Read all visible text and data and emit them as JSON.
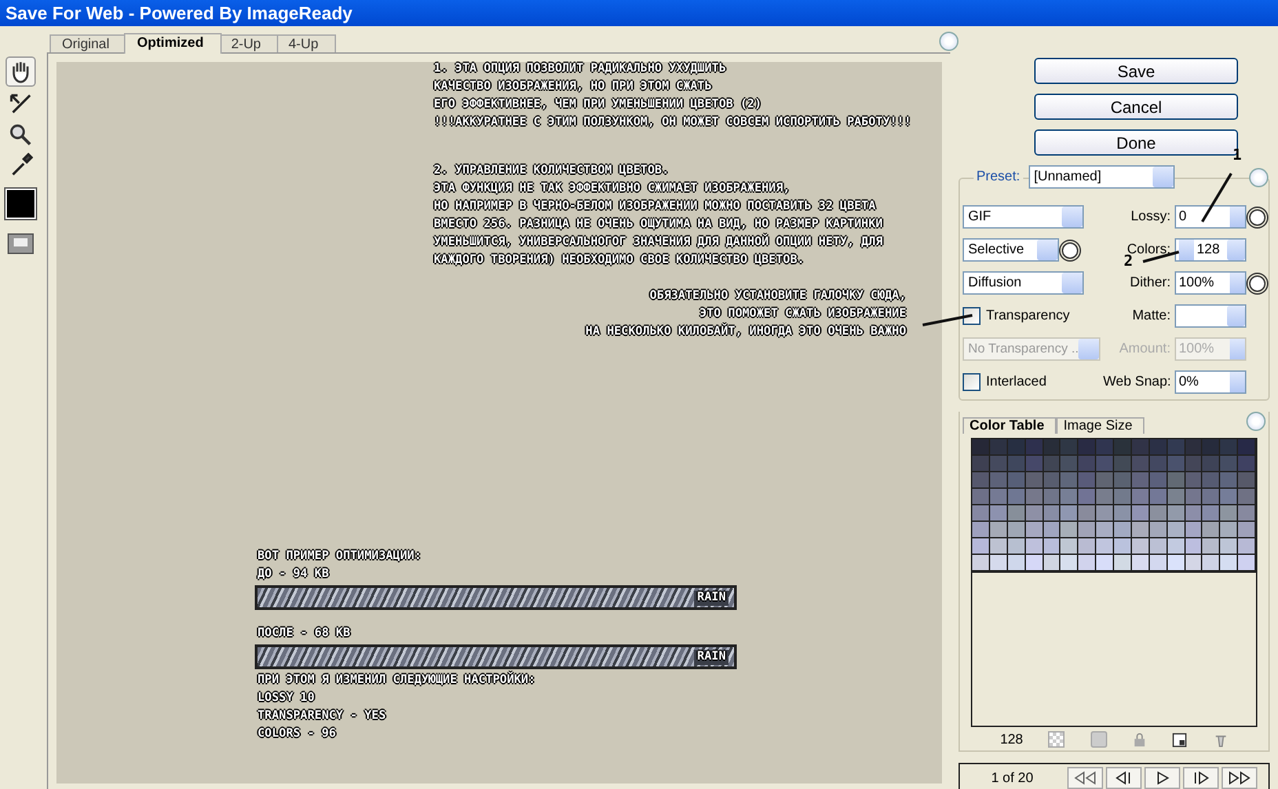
{
  "window": {
    "title": "Save For Web - Powered By ImageReady"
  },
  "tabs": [
    {
      "label": "Original",
      "selected": false
    },
    {
      "label": "Optimized",
      "selected": true
    },
    {
      "label": "2-Up",
      "selected": false
    },
    {
      "label": "4-Up",
      "selected": false
    }
  ],
  "canvas": {
    "notes": [
      {
        "lines": [
          "1. ЭТА ОПЦИЯ ПОЗВОЛИТ РАДИКАЛЬНО УХУДШИТЬ",
          "КАЧЕСТВО ИЗОБРАЖЕНИЯ, НО ПРИ ЭТОМ СЖАТЬ",
          "ЕГО ЭФФЕКТИВНЕЕ, ЧЕМ ПРИ УМЕНЬШЕНИИ ЦВЕТОВ (2)",
          "!!!АККУРАТНЕЕ С ЭТИМ ПОЛЗУНКОМ, ОН МОЖЕТ СОВСЕМ ИСПОРТИТЬ РАБОТУ!!!"
        ]
      },
      {
        "lines": [
          "2. УПРАВЛЕНИЕ КОЛИЧЕСТВОМ ЦВЕТОВ.",
          "ЭТА ФУНКЦИЯ НЕ ТАК ЭФФЕКТИВНО СЖИМАЕТ ИЗОБРАЖЕНИЯ,",
          "НО НАПРИМЕР В ЧЕРНО-БЕЛОМ ИЗОБРАЖЕНИИ МОЖНО ПОСТАВИТЬ 32 ЦВЕТА",
          "ВМЕСТО 256. РАЗНИЦА НЕ ОЧЕНЬ ОЩУТИМА НА ВИД, НО РАЗМЕР КАРТИНКИ",
          "УМЕНЬШИТСЯ, УНИВЕРСАЛЬНОГОГ ЗНАЧЕНИЯ ДЛЯ ДАННОЙ ОПЦИИ НЕТУ, ДЛЯ",
          "КАЖДОГО ТВОРЕНИЯ) НЕОБХОДИМО СВОЕ КОЛИЧЕСТВО ЦВЕТОВ."
        ]
      },
      {
        "lines": [
          "ОБЯЗАТЕЛЬНО УСТАНОВИТЕ ГАЛОЧКУ СЮДА,",
          "ЭТО ПОМОЖЕТ СЖАТЬ ИЗОБРАЖЕНИЕ",
          "НА НЕСКОЛЬКО КИЛОБАЙТ, ИНОГДА ЭТО ОЧЕНЬ ВАЖНО"
        ]
      }
    ],
    "example": [
      {
        "kind": "text",
        "text": "ВОТ ПРИМЕР ОПТИМИЗАЦИИ:"
      },
      {
        "kind": "text",
        "text": "ДО - 94 KB"
      },
      {
        "kind": "banner",
        "text": "RAIN"
      },
      {
        "kind": "gap",
        "text": "ПОСЛЕ - 68 KB"
      },
      {
        "kind": "banner",
        "text": "RAIN"
      },
      {
        "kind": "text",
        "text": "ПРИ ЭТОМ Я ИЗМЕНИЛ СЛЕДУЮЩИЕ НАСТРОЙКИ:"
      },
      {
        "kind": "text",
        "text": "LOSSY 10"
      },
      {
        "kind": "text",
        "text": "TRANSPARENCY - YES"
      },
      {
        "kind": "text",
        "text": "COLORS - 96"
      }
    ]
  },
  "annotations": [
    "1",
    "2"
  ],
  "buttons": [
    "Save",
    "Cancel",
    "Done"
  ],
  "settings": {
    "preset_label": "Preset:",
    "preset": "[Unnamed]",
    "format": "GIF",
    "reduction": "Selective",
    "dither_algorithm": "Diffusion",
    "lossy": {
      "label": "Lossy:",
      "value": "0"
    },
    "colors": {
      "label": "Colors:",
      "value": "128"
    },
    "dither": {
      "label": "Dither:",
      "value": "100%"
    },
    "transparency": {
      "label": "Transparency",
      "checked": false
    },
    "matte": {
      "label": "Matte:"
    },
    "transparency_dither": {
      "value": "No Transparency ..",
      "disabled": true
    },
    "amount": {
      "label": "Amount:",
      "value": "100%",
      "disabled": true
    },
    "interlaced": {
      "label": "Interlaced",
      "checked": false
    },
    "web_snap": {
      "label": "Web Snap:",
      "value": "0%"
    }
  },
  "panel_tabs": [
    {
      "label": "Color Table",
      "selected": true
    },
    {
      "label": "Image Size",
      "selected": false
    }
  ],
  "color_count": "128",
  "animation": {
    "frame": "1 of 20"
  }
}
